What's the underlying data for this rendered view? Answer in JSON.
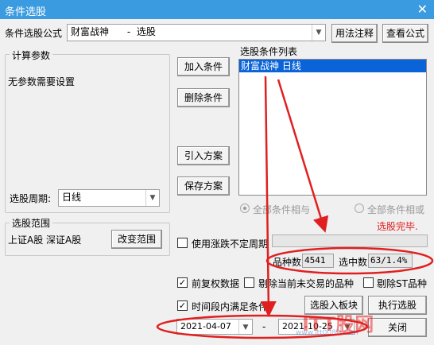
{
  "window": {
    "title": "条件选股",
    "close_glyph": "✕"
  },
  "formula": {
    "label": "条件选股公式",
    "value": "财富战神      -  选股",
    "usage_button": "用法注释",
    "view_button": "查看公式"
  },
  "params": {
    "group_title": "计算参数",
    "message": "无参数需要设置",
    "period_label": "选股周期:",
    "period_value": "日线"
  },
  "condition_buttons": {
    "add": "加入条件",
    "delete": "删除条件",
    "import": "引入方案",
    "save": "保存方案"
  },
  "condition_list": {
    "title": "选股条件列表",
    "items": [
      "财富战神  日线"
    ]
  },
  "logic": {
    "all_and": "全部条件相与",
    "all_or": "全部条件相或"
  },
  "status": "选股完毕.",
  "range": {
    "group_title": "选股范围",
    "markets": "上证A股  深证A股",
    "change_button": "改变范围"
  },
  "options": {
    "variable_period": "使用涨跌不定周期",
    "forward_adjust": "前复权数据",
    "exclude_untraded": "剔除当前未交易的品种",
    "exclude_st": "剔除ST品种",
    "time_range": "时间段内满足条件"
  },
  "stats": {
    "count_label": "品种数",
    "count_value": "4541",
    "selected_label": "选中数",
    "selected_value": "63/1.4%"
  },
  "dates": {
    "start": "2021-04-07",
    "separator": "-",
    "end": "2021-10-25"
  },
  "actions": {
    "to_block": "选股入板块",
    "execute": "执行选股",
    "close": "关闭"
  },
  "watermark": "ITT股网 www.itt0082.com",
  "colors": {
    "titlebar": "#3b9be0",
    "selection": "#0a64d8",
    "annotation": "#e02020",
    "status": "#e02020"
  }
}
